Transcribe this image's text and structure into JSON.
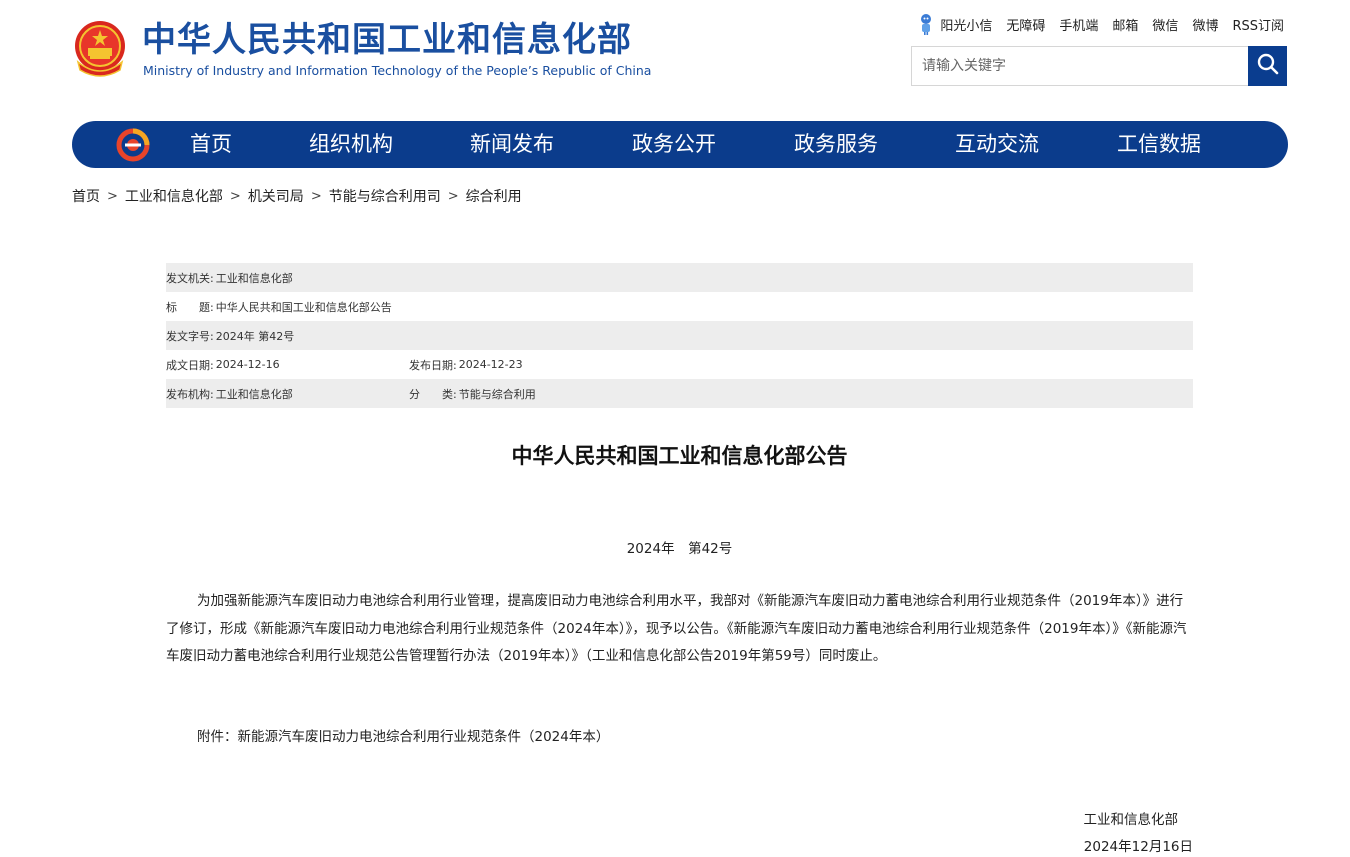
{
  "header": {
    "title_cn": "中华人民共和国工业和信息化部",
    "title_en": "Ministry of Industry and Information Technology of the People’s Republic of China",
    "emblem_icon": "national-emblem-icon",
    "top_links": [
      "阳光小信",
      "无障碍",
      "手机端",
      "邮箱",
      "微信",
      "微博",
      "RSS订阅"
    ],
    "search": {
      "placeholder": "请输入关键字",
      "button_icon": "search-icon"
    }
  },
  "nav": {
    "logo_icon": "miit-logo-icon",
    "items": [
      "首页",
      "组织机构",
      "新闻发布",
      "政务公开",
      "政务服务",
      "互动交流",
      "工信数据"
    ]
  },
  "breadcrumb": {
    "items": [
      "首页",
      "工业和信息化部",
      "机关司局",
      "节能与综合利用司",
      "综合利用"
    ],
    "separator": ">"
  },
  "meta": {
    "issuer_label": "发文机关:",
    "issuer": "工业和信息化部",
    "title_label": "标　　题:",
    "title": "中华人民共和国工业和信息化部公告",
    "doc_no_label": "发文字号:",
    "doc_no": "2024年 第42号",
    "date_written_label": "成文日期:",
    "date_written": "2024-12-16",
    "date_published_label": "发布日期:",
    "date_published": "2024-12-23",
    "publisher_label": "发布机构:",
    "publisher": "工业和信息化部",
    "category_label": "分　　类:",
    "category": "节能与综合利用"
  },
  "article": {
    "title": "中华人民共和国工业和信息化部公告",
    "number": "2024年　第42号",
    "body": "为加强新能源汽车废旧动力电池综合利用行业管理，提高废旧动力电池综合利用水平，我部对《新能源汽车废旧动力蓄电池综合利用行业规范条件（2019年本）》进行了修订，形成《新能源汽车废旧动力电池综合利用行业规范条件（2024年本）》，现予以公告。《新能源汽车废旧动力蓄电池综合利用行业规范条件（2019年本）》《新能源汽车废旧动力蓄电池综合利用行业规范公告管理暂行办法（2019年本）》（工业和信息化部公告2019年第59号）同时废止。",
    "attachment": "附件：新能源汽车废旧动力电池综合利用行业规范条件（2024年本）",
    "signature_org": "工业和信息化部",
    "signature_date": "2024年12月16日"
  },
  "colors": {
    "brand_blue": "#0b3c8c",
    "title_blue": "#1a4fa0",
    "meta_shade": "#ededed"
  }
}
